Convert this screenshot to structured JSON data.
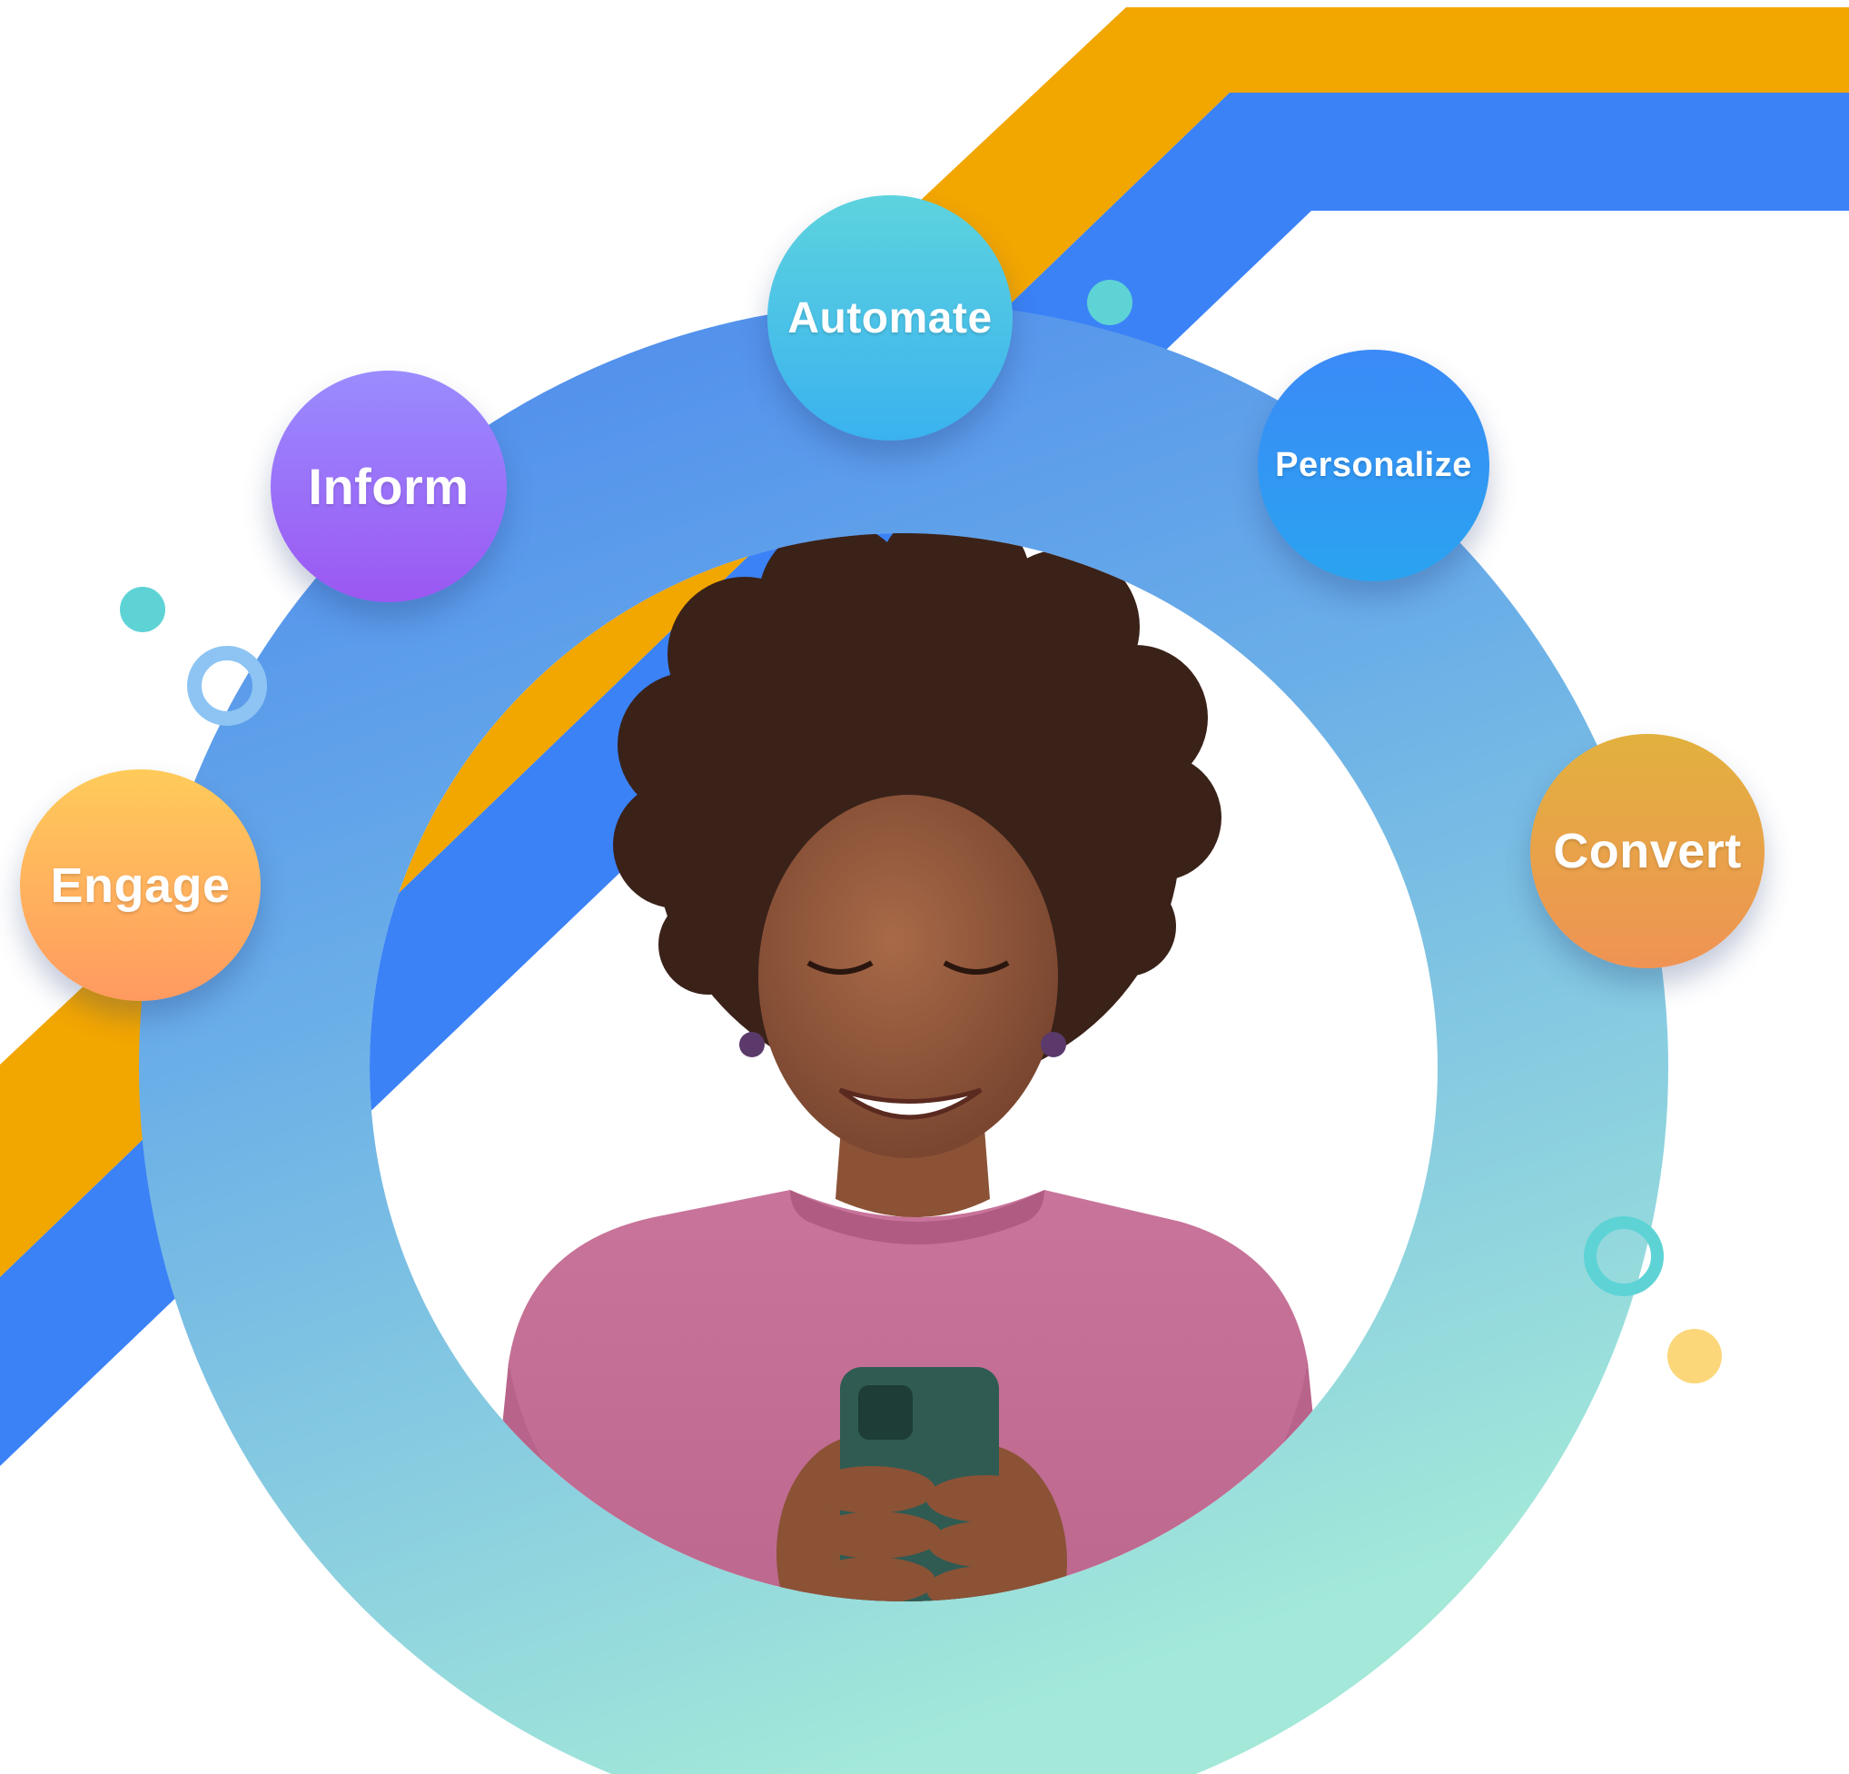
{
  "bubbles": {
    "automate": "Automate",
    "inform": "Inform",
    "personalize": "Personalize",
    "engage": "Engage",
    "convert": "Convert"
  },
  "colors": {
    "orange_stripe": "#f2a600",
    "blue_stripe": "#3b82f6",
    "ring_top": "#4a8cef",
    "ring_bottom": "#9fe6d8",
    "dot_teal": "#5ed3d6",
    "dot_yellow": "#fbd77a"
  },
  "photo": {
    "subject": "smiling woman with curly hair in pink sweater looking at smartphone",
    "icons": [
      "person-photo",
      "smartphone-icon"
    ]
  }
}
